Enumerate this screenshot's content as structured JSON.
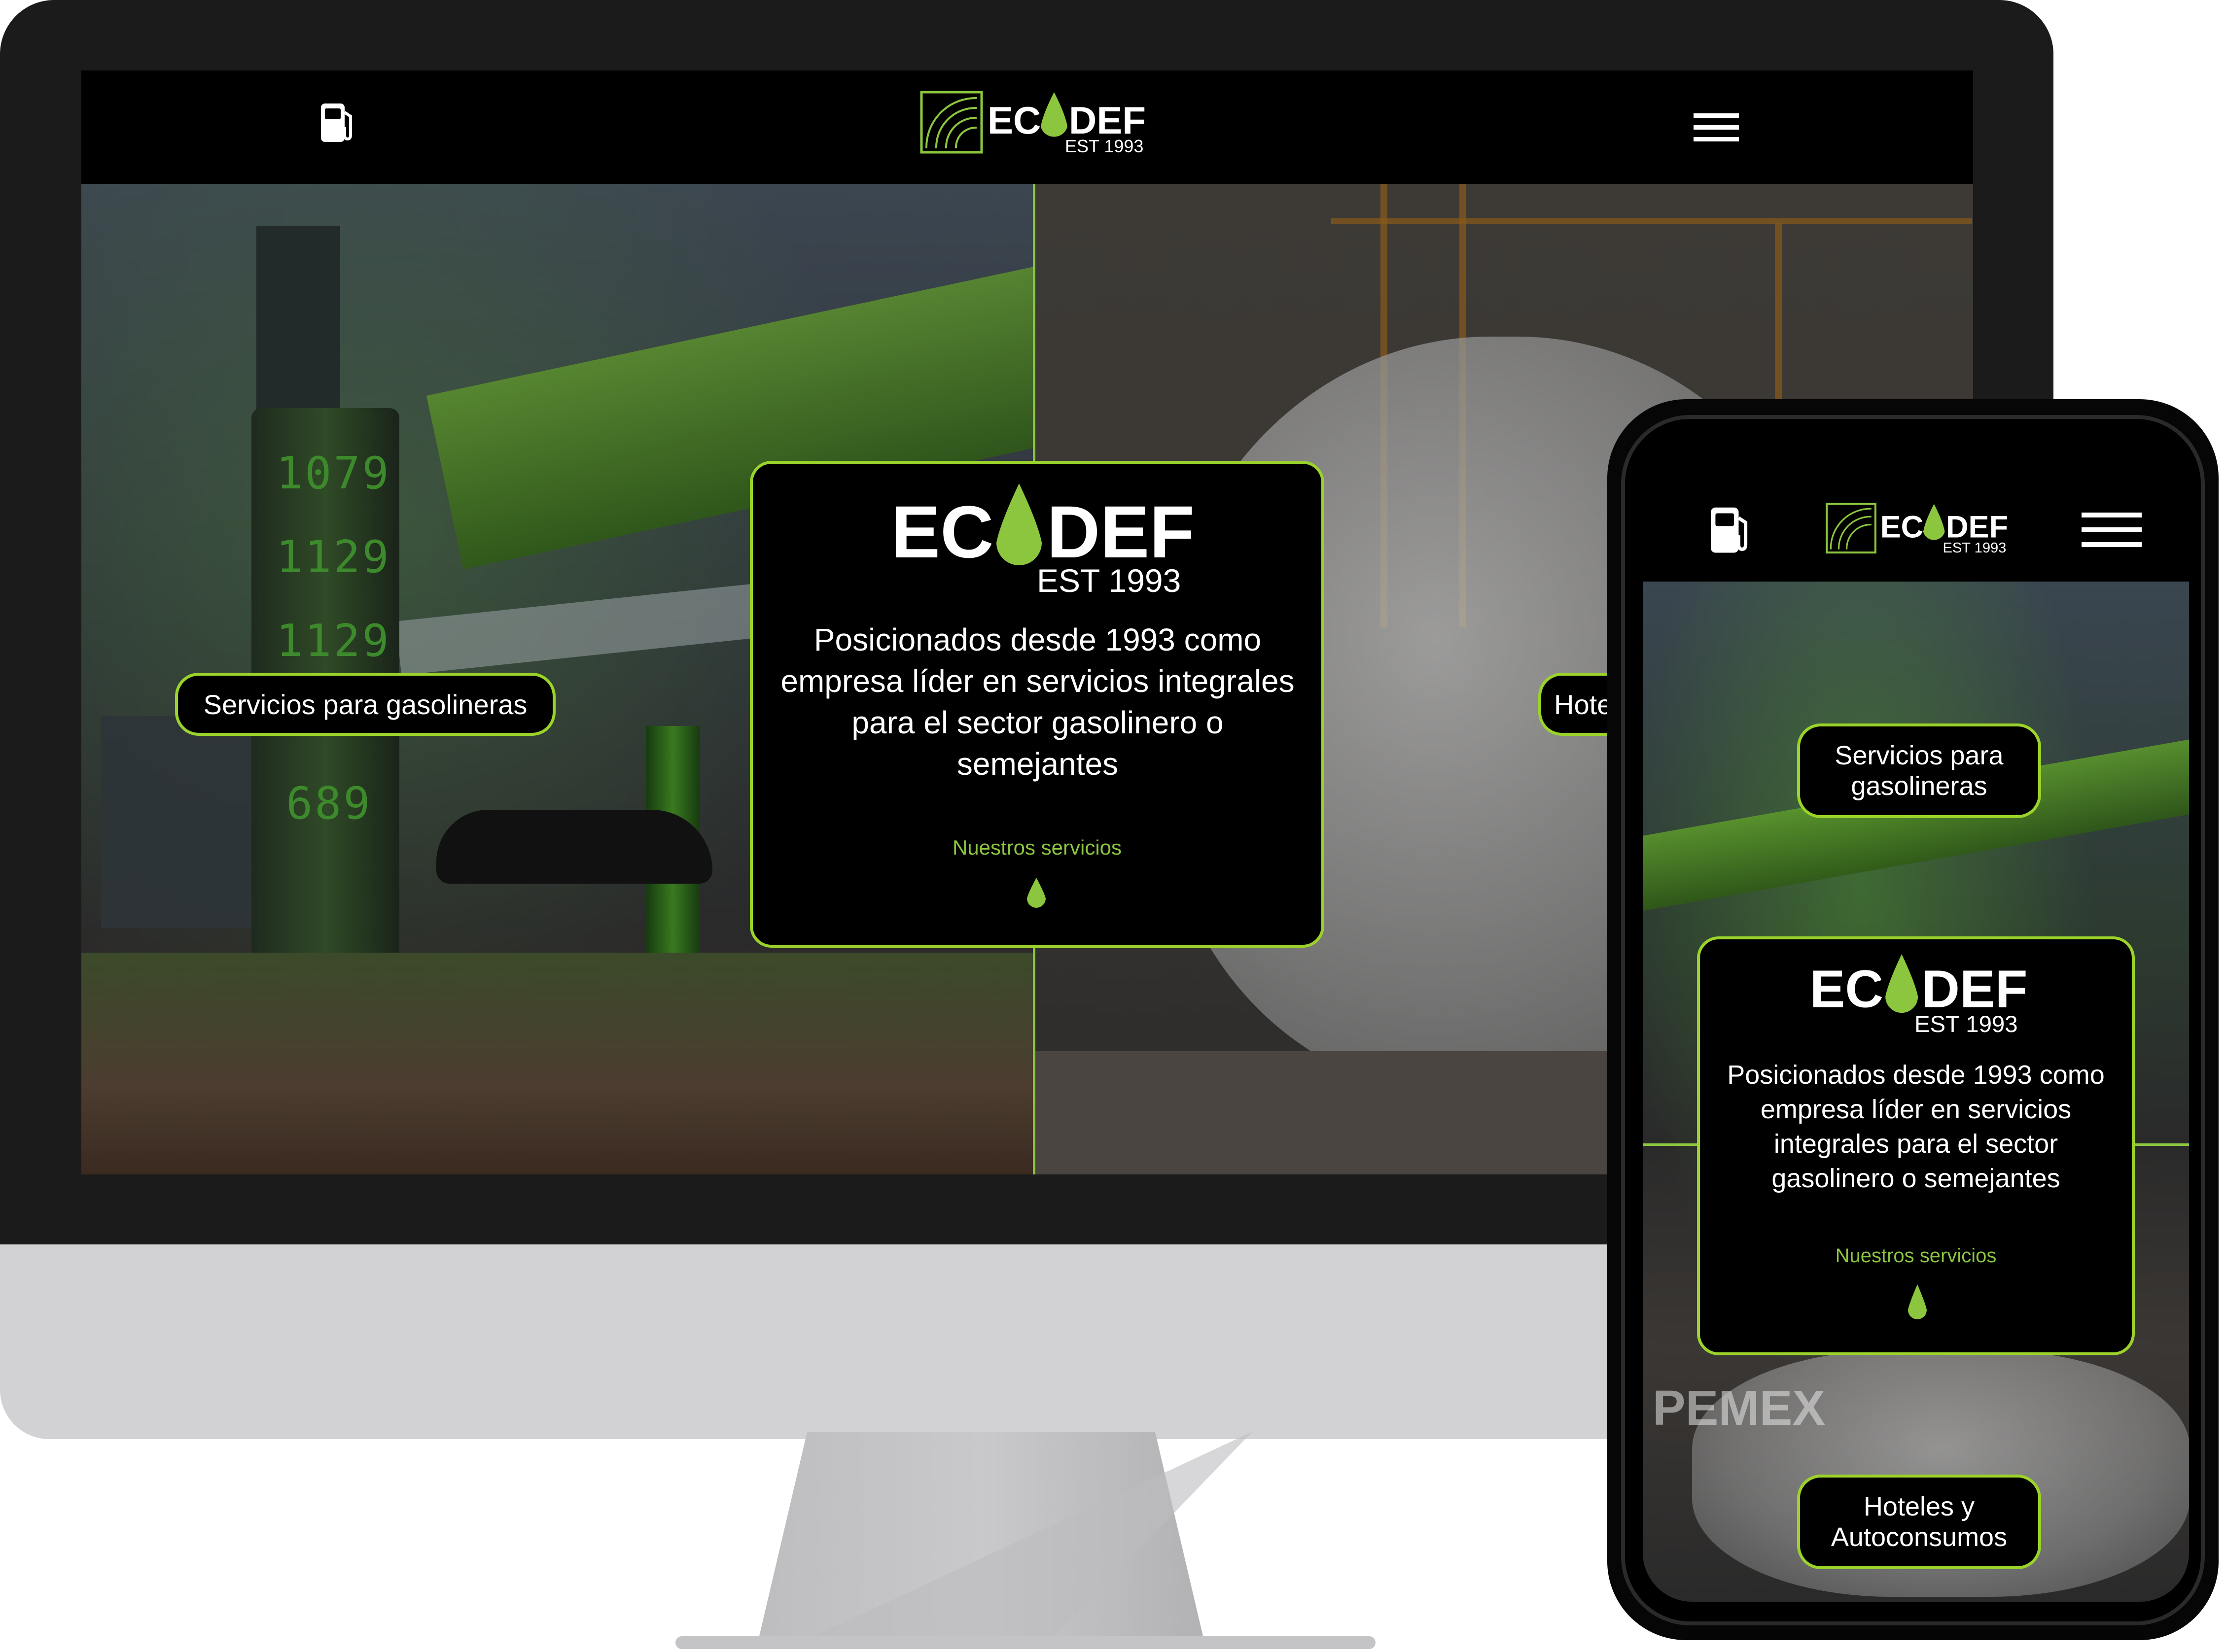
{
  "brand": {
    "name_part1": "EC",
    "name_part2": "DEF",
    "tagline": "EST 1993",
    "accent_color": "#8cc63f"
  },
  "nav": {
    "left_icon": "fuel-pump-icon",
    "right_icon": "hamburger-menu-icon"
  },
  "hero": {
    "left_pill": "Servicios para gasolineras",
    "right_pill_partial": "Hote",
    "heading": "Posicionados desde 1993 como empresa líder en servicios integrales para el sector gasolinero o semejantes",
    "link": "Nuestros servicios",
    "drop_icon": "drop-icon"
  },
  "left_photo": {
    "price_1": "1079",
    "price_2": "1129",
    "price_3": "1129",
    "price_4": "689"
  },
  "mobile": {
    "pill_1": "Servicios para gasolineras",
    "pill_2": "Hoteles y Autoconsumos",
    "heading": "Posicionados desde 1993 como empresa líder en servicios integrales para el sector gasolinero o semejantes",
    "link": "Nuestros servicios",
    "background_sign": "PEMEX"
  }
}
